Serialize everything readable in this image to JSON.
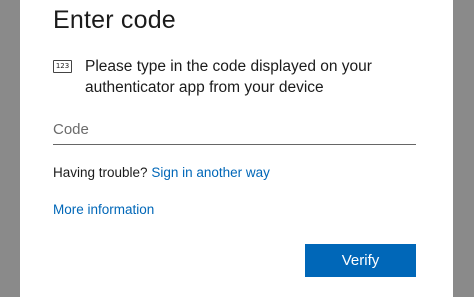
{
  "dialog": {
    "title": "Enter code",
    "icon_label": "123",
    "description": "Please type in the code displayed on your authenticator app from your device",
    "code_placeholder": "Code",
    "code_value": "",
    "trouble_text": "Having trouble? ",
    "sign_in_other_way": "Sign in another way",
    "more_information": "More information",
    "verify_label": "Verify"
  },
  "colors": {
    "accent": "#0067b8",
    "background_dim": "#8a8a8a",
    "card": "#ffffff"
  }
}
